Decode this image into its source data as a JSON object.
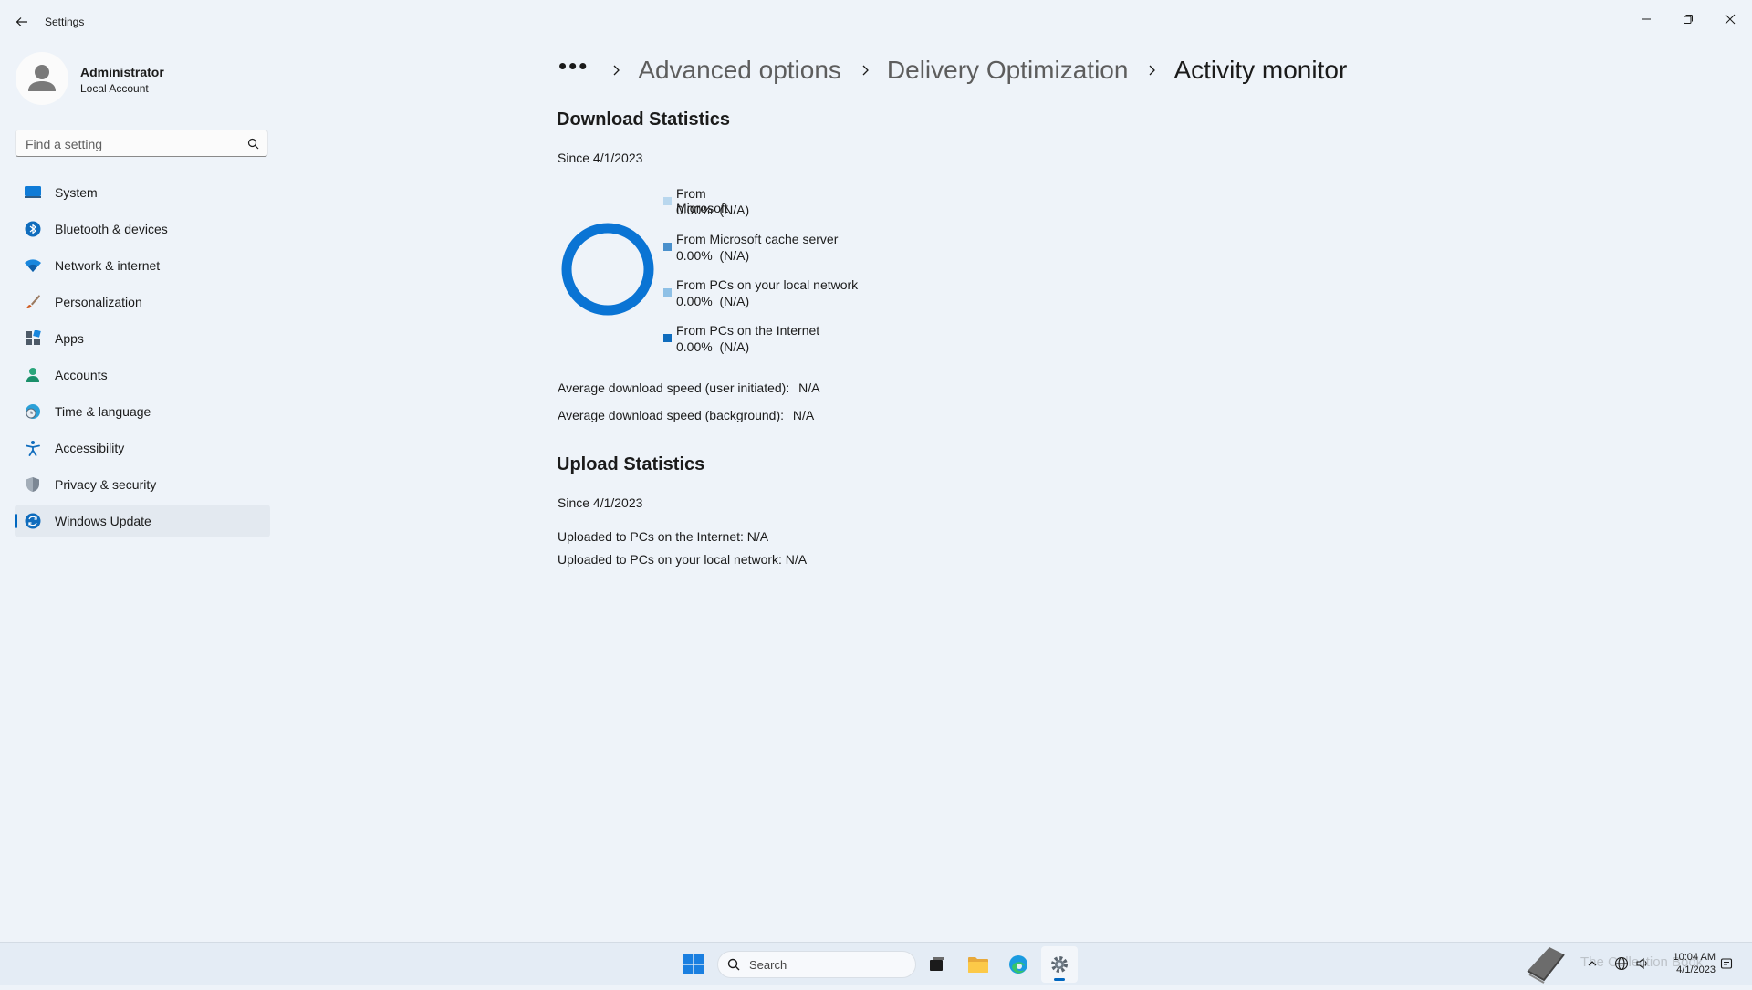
{
  "window": {
    "title": "Settings"
  },
  "user": {
    "name": "Administrator",
    "account_type": "Local Account"
  },
  "search": {
    "placeholder": "Find a setting"
  },
  "sidebar": {
    "items": [
      {
        "label": "System",
        "icon": "system-icon"
      },
      {
        "label": "Bluetooth & devices",
        "icon": "bluetooth-icon"
      },
      {
        "label": "Network & internet",
        "icon": "wifi-icon"
      },
      {
        "label": "Personalization",
        "icon": "brush-icon"
      },
      {
        "label": "Apps",
        "icon": "apps-icon"
      },
      {
        "label": "Accounts",
        "icon": "person-icon"
      },
      {
        "label": "Time & language",
        "icon": "globe-clock-icon"
      },
      {
        "label": "Accessibility",
        "icon": "accessibility-icon"
      },
      {
        "label": "Privacy & security",
        "icon": "shield-icon"
      },
      {
        "label": "Windows Update",
        "icon": "update-icon",
        "selected": true
      }
    ]
  },
  "breadcrumb": {
    "more": "•••",
    "items": [
      "Advanced options",
      "Delivery Optimization"
    ],
    "current": "Activity monitor"
  },
  "download": {
    "heading": "Download Statistics",
    "since": "Since 4/1/2023",
    "legend": [
      {
        "label": "From Microsoft",
        "value": "0.00%  (N/A)",
        "color": "#b9d7ee"
      },
      {
        "label": "From Microsoft cache server",
        "value": "0.00%  (N/A)",
        "color": "#4a90cc"
      },
      {
        "label": "From PCs on your local network",
        "value": "0.00%  (N/A)",
        "color": "#8ec0e6"
      },
      {
        "label": "From PCs on the Internet",
        "value": "0.00%  (N/A)",
        "color": "#0f6cbd"
      }
    ],
    "avg_user_label": "Average download speed (user initiated):",
    "avg_user_value": "N/A",
    "avg_bg_label": "Average download speed (background):",
    "avg_bg_value": "N/A",
    "ring_color": "#0a74d4"
  },
  "upload": {
    "heading": "Upload Statistics",
    "since": "Since 4/1/2023",
    "internet": "Uploaded to PCs on the Internet: N/A",
    "local": "Uploaded to PCs on your local network: N/A"
  },
  "taskbar": {
    "search_label": "Search",
    "watermark": "The Collection Book",
    "time": "10:04 AM",
    "date": "4/1/2023"
  },
  "colors": {
    "accent": "#0067c0",
    "background": "#eef3f9"
  }
}
